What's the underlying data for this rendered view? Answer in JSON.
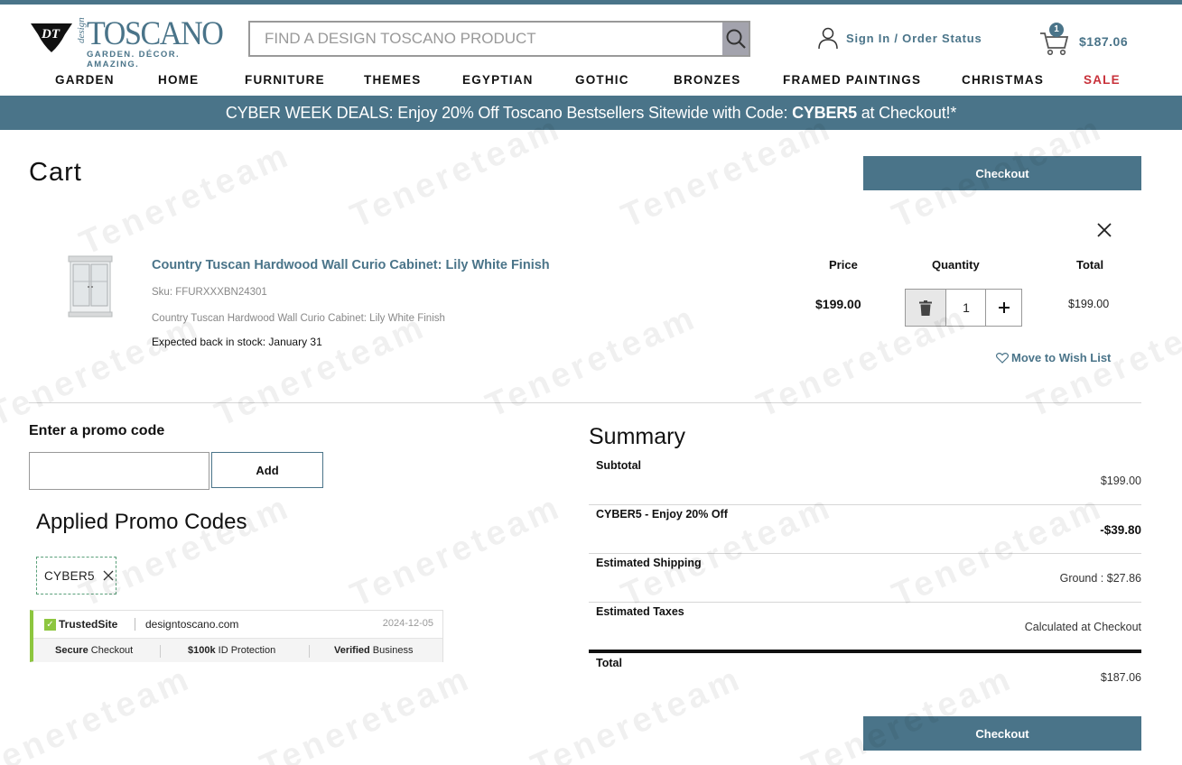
{
  "header": {
    "brand_script": "design",
    "brand_name": "TOSCANO",
    "brand_tagline": "GARDEN. DÉCOR. AMAZING.",
    "search_placeholder": "FIND A DESIGN TOSCANO PRODUCT",
    "signin_label": "Sign In / Order Status",
    "cart_count": "1",
    "cart_amount": "$187.06"
  },
  "nav": {
    "items": [
      "GARDEN",
      "HOME",
      "FURNITURE",
      "THEMES",
      "EGYPTIAN",
      "GOTHIC",
      "BRONZES",
      "FRAMED PAINTINGS",
      "CHRISTMAS",
      "SALE"
    ]
  },
  "promo_banner": {
    "prefix": "CYBER WEEK DEALS: Enjoy 20% Off Toscano Bestsellers Sitewide with Code: ",
    "code": "CYBER5",
    "suffix": " at Checkout!*"
  },
  "cart": {
    "title": "Cart",
    "checkout_label": "Checkout",
    "columns": {
      "price": "Price",
      "quantity": "Quantity",
      "total": "Total"
    },
    "item": {
      "name": "Country Tuscan Hardwood Wall Curio Cabinet: Lily White Finish",
      "sku": "Sku: FFURXXXBN24301",
      "description": "Country Tuscan Hardwood Wall Curio Cabinet: Lily White Finish",
      "stock": "Expected back in stock: January 31",
      "price": "$199.00",
      "quantity": "1",
      "total": "$199.00",
      "wish_label": "Move to Wish List"
    }
  },
  "promo": {
    "label": "Enter a promo code",
    "add_label": "Add",
    "applied_title": "Applied Promo Codes",
    "applied_codes": [
      "CYBER5"
    ]
  },
  "trusted_site": {
    "logo": "TrustedSite",
    "domain": "designtoscano.com",
    "date": "2024-12-05",
    "badges": [
      {
        "bold": "Secure",
        "rest": " Checkout"
      },
      {
        "bold": "$100k",
        "rest": " ID Protection"
      },
      {
        "bold": "Verified",
        "rest": " Business"
      }
    ]
  },
  "summary": {
    "title": "Summary",
    "rows": [
      {
        "label": "Subtotal",
        "value": "$199.00"
      },
      {
        "label": "CYBER5 - Enjoy 20% Off",
        "value": "-$39.80"
      },
      {
        "label": "Estimated Shipping",
        "value": "Ground : $27.86"
      },
      {
        "label": "Estimated Taxes",
        "value": "Calculated at Checkout"
      }
    ],
    "total_label": "Total",
    "total_value": "$187.06"
  },
  "watermark": "Tenereteam",
  "colors": {
    "accent": "#4a7489",
    "sale": "#c8313a",
    "trusted_green": "#8dc63f",
    "promo_border": "#5aa07a"
  }
}
